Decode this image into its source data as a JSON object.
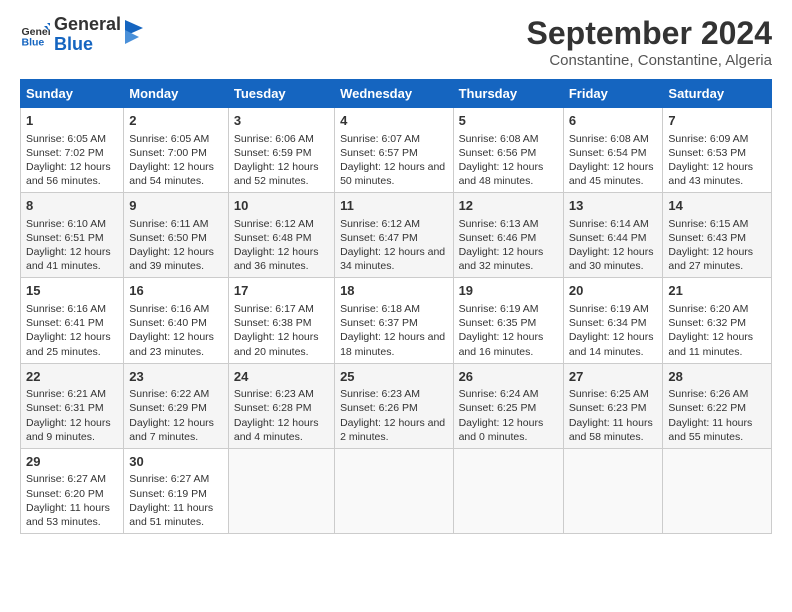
{
  "logo": {
    "line1": "General",
    "line2": "Blue"
  },
  "title": "September 2024",
  "subtitle": "Constantine, Constantine, Algeria",
  "days_header": [
    "Sunday",
    "Monday",
    "Tuesday",
    "Wednesday",
    "Thursday",
    "Friday",
    "Saturday"
  ],
  "weeks": [
    [
      {
        "day": "1",
        "sunrise": "6:05 AM",
        "sunset": "7:02 PM",
        "daylight": "12 hours and 56 minutes."
      },
      {
        "day": "2",
        "sunrise": "6:05 AM",
        "sunset": "7:00 PM",
        "daylight": "12 hours and 54 minutes."
      },
      {
        "day": "3",
        "sunrise": "6:06 AM",
        "sunset": "6:59 PM",
        "daylight": "12 hours and 52 minutes."
      },
      {
        "day": "4",
        "sunrise": "6:07 AM",
        "sunset": "6:57 PM",
        "daylight": "12 hours and 50 minutes."
      },
      {
        "day": "5",
        "sunrise": "6:08 AM",
        "sunset": "6:56 PM",
        "daylight": "12 hours and 48 minutes."
      },
      {
        "day": "6",
        "sunrise": "6:08 AM",
        "sunset": "6:54 PM",
        "daylight": "12 hours and 45 minutes."
      },
      {
        "day": "7",
        "sunrise": "6:09 AM",
        "sunset": "6:53 PM",
        "daylight": "12 hours and 43 minutes."
      }
    ],
    [
      {
        "day": "8",
        "sunrise": "6:10 AM",
        "sunset": "6:51 PM",
        "daylight": "12 hours and 41 minutes."
      },
      {
        "day": "9",
        "sunrise": "6:11 AM",
        "sunset": "6:50 PM",
        "daylight": "12 hours and 39 minutes."
      },
      {
        "day": "10",
        "sunrise": "6:12 AM",
        "sunset": "6:48 PM",
        "daylight": "12 hours and 36 minutes."
      },
      {
        "day": "11",
        "sunrise": "6:12 AM",
        "sunset": "6:47 PM",
        "daylight": "12 hours and 34 minutes."
      },
      {
        "day": "12",
        "sunrise": "6:13 AM",
        "sunset": "6:46 PM",
        "daylight": "12 hours and 32 minutes."
      },
      {
        "day": "13",
        "sunrise": "6:14 AM",
        "sunset": "6:44 PM",
        "daylight": "12 hours and 30 minutes."
      },
      {
        "day": "14",
        "sunrise": "6:15 AM",
        "sunset": "6:43 PM",
        "daylight": "12 hours and 27 minutes."
      }
    ],
    [
      {
        "day": "15",
        "sunrise": "6:16 AM",
        "sunset": "6:41 PM",
        "daylight": "12 hours and 25 minutes."
      },
      {
        "day": "16",
        "sunrise": "6:16 AM",
        "sunset": "6:40 PM",
        "daylight": "12 hours and 23 minutes."
      },
      {
        "day": "17",
        "sunrise": "6:17 AM",
        "sunset": "6:38 PM",
        "daylight": "12 hours and 20 minutes."
      },
      {
        "day": "18",
        "sunrise": "6:18 AM",
        "sunset": "6:37 PM",
        "daylight": "12 hours and 18 minutes."
      },
      {
        "day": "19",
        "sunrise": "6:19 AM",
        "sunset": "6:35 PM",
        "daylight": "12 hours and 16 minutes."
      },
      {
        "day": "20",
        "sunrise": "6:19 AM",
        "sunset": "6:34 PM",
        "daylight": "12 hours and 14 minutes."
      },
      {
        "day": "21",
        "sunrise": "6:20 AM",
        "sunset": "6:32 PM",
        "daylight": "12 hours and 11 minutes."
      }
    ],
    [
      {
        "day": "22",
        "sunrise": "6:21 AM",
        "sunset": "6:31 PM",
        "daylight": "12 hours and 9 minutes."
      },
      {
        "day": "23",
        "sunrise": "6:22 AM",
        "sunset": "6:29 PM",
        "daylight": "12 hours and 7 minutes."
      },
      {
        "day": "24",
        "sunrise": "6:23 AM",
        "sunset": "6:28 PM",
        "daylight": "12 hours and 4 minutes."
      },
      {
        "day": "25",
        "sunrise": "6:23 AM",
        "sunset": "6:26 PM",
        "daylight": "12 hours and 2 minutes."
      },
      {
        "day": "26",
        "sunrise": "6:24 AM",
        "sunset": "6:25 PM",
        "daylight": "12 hours and 0 minutes."
      },
      {
        "day": "27",
        "sunrise": "6:25 AM",
        "sunset": "6:23 PM",
        "daylight": "11 hours and 58 minutes."
      },
      {
        "day": "28",
        "sunrise": "6:26 AM",
        "sunset": "6:22 PM",
        "daylight": "11 hours and 55 minutes."
      }
    ],
    [
      {
        "day": "29",
        "sunrise": "6:27 AM",
        "sunset": "6:20 PM",
        "daylight": "11 hours and 53 minutes."
      },
      {
        "day": "30",
        "sunrise": "6:27 AM",
        "sunset": "6:19 PM",
        "daylight": "11 hours and 51 minutes."
      },
      null,
      null,
      null,
      null,
      null
    ]
  ]
}
